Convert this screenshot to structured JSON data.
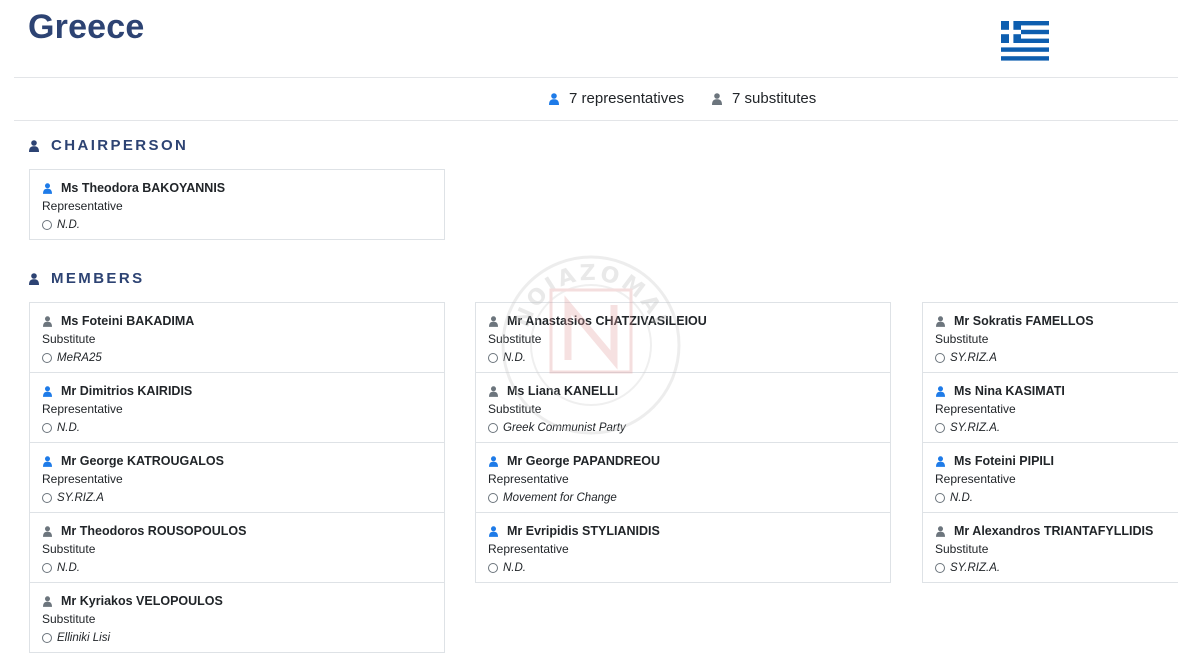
{
  "country": "Greece",
  "stats": {
    "representatives": "7 representatives",
    "substitutes": "7 substitutes"
  },
  "sections": {
    "chairperson": "CHAIRPERSON",
    "members": "MEMBERS"
  },
  "colors": {
    "title": "#2d4373",
    "representative_icon": "#1e7be8",
    "substitute_icon": "#6c757d",
    "border": "#dee2e6"
  },
  "icons": {
    "representative": "person-icon",
    "substitute": "person-icon",
    "party": "circle-icon"
  },
  "chairperson": {
    "name": "Ms Theodora BAKOYANNIS",
    "role": "Representative",
    "party": "N.D."
  },
  "members": [
    [
      {
        "name": "Ms Foteini BAKADIMA",
        "role": "Substitute",
        "party": "MeRA25"
      },
      {
        "name": "Mr Dimitrios KAIRIDIS",
        "role": "Representative",
        "party": "N.D."
      },
      {
        "name": "Mr George KATROUGALOS",
        "role": "Representative",
        "party": "SY.RIZ.A"
      },
      {
        "name": "Mr Theodoros ROUSOPOULOS",
        "role": "Substitute",
        "party": "N.D."
      },
      {
        "name": "Mr Kyriakos VELOPOULOS",
        "role": "Substitute",
        "party": "Elliniki Lisi"
      }
    ],
    [
      {
        "name": "Mr Anastasios CHATZIVASILEIOU",
        "role": "Substitute",
        "party": "N.D."
      },
      {
        "name": "Ms Liana KANELLI",
        "role": "Substitute",
        "party": "Greek Communist Party"
      },
      {
        "name": "Mr George PAPANDREOU",
        "role": "Representative",
        "party": "Movement for Change"
      },
      {
        "name": "Mr Evripidis STYLIANIDIS",
        "role": "Representative",
        "party": "N.D."
      }
    ],
    [
      {
        "name": "Mr Sokratis FAMELLOS",
        "role": "Substitute",
        "party": "SY.RIZ.A"
      },
      {
        "name": "Ms Nina KASIMATI",
        "role": "Representative",
        "party": "SY.RIZ.A."
      },
      {
        "name": "Ms Foteini PIPILI",
        "role": "Representative",
        "party": "N.D."
      },
      {
        "name": "Mr Alexandros TRIANTAFYLLIDIS",
        "role": "Substitute",
        "party": "SY.RIZ.A."
      }
    ]
  ],
  "watermark_text": "NOIAZOMAI"
}
